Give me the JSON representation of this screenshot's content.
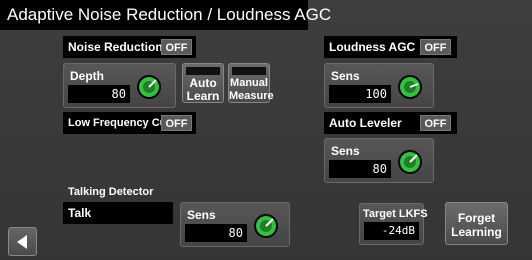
{
  "window": {
    "title": "Adaptive Noise Reduction / Loudness AGC"
  },
  "noise_reduction": {
    "label": "Noise Reduction",
    "toggle": "OFF",
    "depth_label": "Depth",
    "depth_value": "80",
    "auto_learn_label": "Auto\nLearn",
    "manual_measure_label": "Manual\nMeasure"
  },
  "low_frequency_cut": {
    "label": "Low Frequency Cut",
    "toggle": "OFF"
  },
  "loudness_agc": {
    "label": "Loudness AGC",
    "toggle": "OFF",
    "sens_label": "Sens",
    "sens_value": "100"
  },
  "auto_leveler": {
    "label": "Auto Leveler",
    "toggle": "OFF",
    "sens_label": "Sens",
    "sens_value": "80"
  },
  "talking_detector": {
    "label": "Talking Detector",
    "status": "Talk",
    "sens_label": "Sens",
    "sens_value": "80"
  },
  "target_lkfs": {
    "label": "Target LKFS",
    "value": "-24dB"
  },
  "forget_learning": {
    "label": "Forget\nLearning"
  },
  "icons": {
    "back": "back-arrow-icon",
    "knob": "knob-icon"
  },
  "colors": {
    "knob": "#2fc43d",
    "indicator": "#1f7e2a"
  }
}
